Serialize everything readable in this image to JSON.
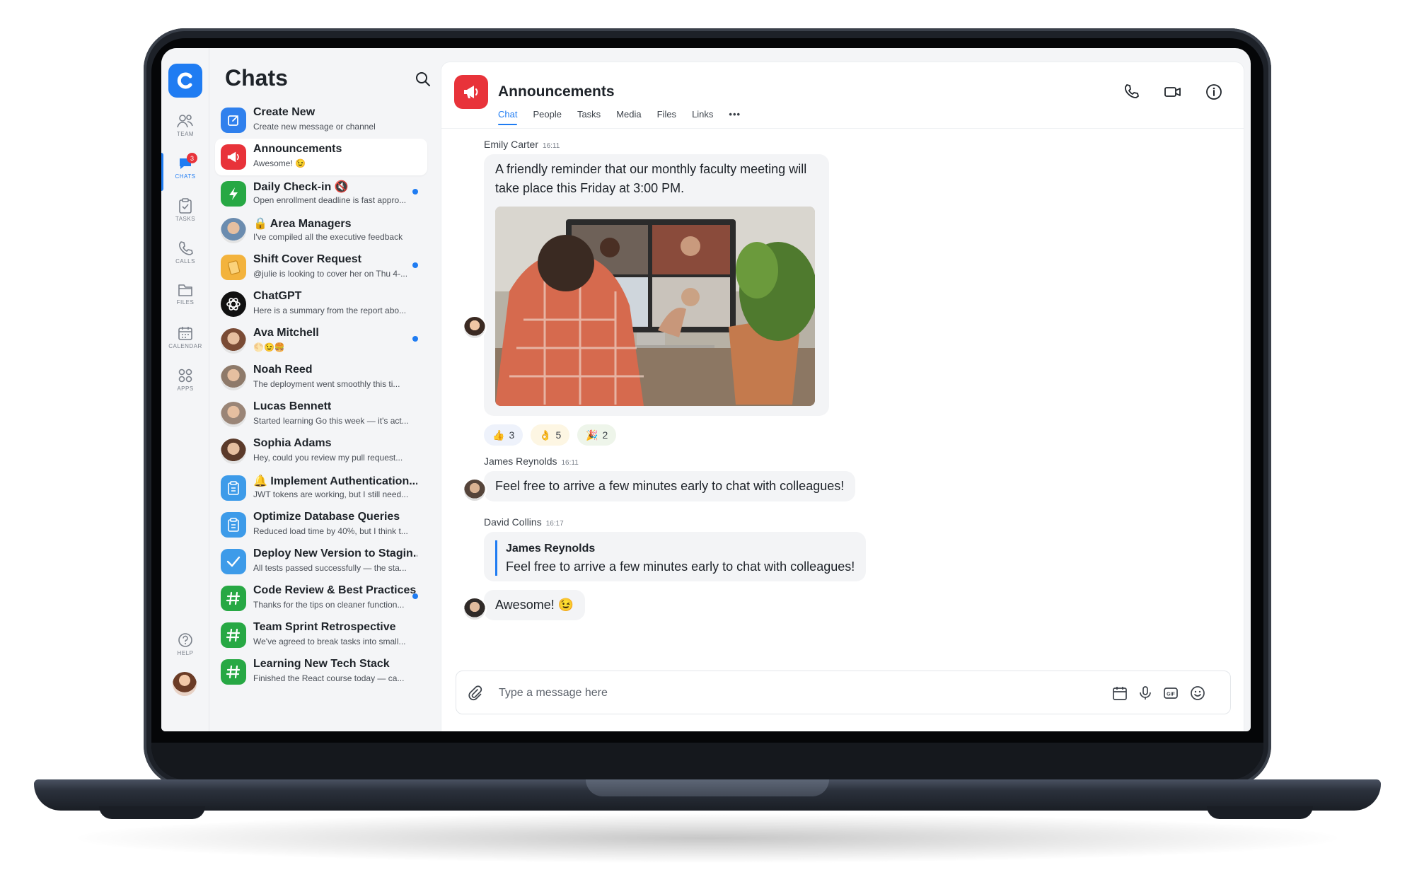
{
  "rail": {
    "items": [
      {
        "label": "TEAM"
      },
      {
        "label": "CHATS",
        "badge": "3"
      },
      {
        "label": "TASKS"
      },
      {
        "label": "CALLS"
      },
      {
        "label": "FILES"
      },
      {
        "label": "CALENDAR"
      },
      {
        "label": "APPS"
      }
    ],
    "help_label": "HELP"
  },
  "chat_list": {
    "title": "Chats",
    "items": [
      {
        "name": "Create New",
        "preview": "Create new message or channel",
        "icon": "compose-icon",
        "color": "#2f80ed"
      },
      {
        "name": "Announcements",
        "preview": "Awesome! 😉",
        "icon": "megaphone-icon",
        "color": "#e8333a"
      },
      {
        "name": "Daily Check-in 🔇",
        "preview": "Open enrollment deadline is fast appro...",
        "icon": "bolt-icon",
        "color": "#27a844",
        "unread": true
      },
      {
        "name": "🔒 Area Managers",
        "preview": "I've compiled all the executive feedback",
        "icon": "group-photo",
        "color": "#6b8caf"
      },
      {
        "name": "Shift Cover Request",
        "preview": "@julie is looking to cover her on Thu 4-...",
        "icon": "notebook-icon",
        "color": "#f3b33d",
        "unread": true
      },
      {
        "name": "ChatGPT",
        "preview": "Here is a summary from the report abo...",
        "icon": "openai-icon",
        "color": "#111111"
      },
      {
        "name": "Ava Mitchell",
        "preview": "🌕😉🍔",
        "icon": "avatar",
        "color": "#7a4b35",
        "unread": true
      },
      {
        "name": "Noah Reed",
        "preview": "The deployment went smoothly this ti...",
        "icon": "avatar",
        "color": "#8e7a6a"
      },
      {
        "name": "Lucas Bennett",
        "preview": "Started learning Go this week — it's act...",
        "icon": "avatar",
        "color": "#9a8577"
      },
      {
        "name": "Sophia Adams",
        "preview": "Hey, could you review my pull request...",
        "icon": "avatar",
        "color": "#5b3a2a"
      },
      {
        "name": "🔔 Implement Authentication...",
        "preview": "JWT tokens are working, but I still need...",
        "icon": "clipboard-icon",
        "color": "#3d9be9"
      },
      {
        "name": "Optimize Database Queries",
        "preview": "Reduced load time by 40%, but I think t...",
        "icon": "clipboard-icon",
        "color": "#3d9be9"
      },
      {
        "name": "Deploy New Version to Stagin...",
        "preview": "All tests passed successfully — the sta...",
        "icon": "check-icon",
        "color": "#3d9be9"
      },
      {
        "name": "Code Review & Best Practices",
        "preview": "Thanks for the tips on cleaner function...",
        "icon": "hash-icon",
        "color": "#27a844",
        "unread": true
      },
      {
        "name": "Team Sprint Retrospective",
        "preview": "We've agreed to break tasks into small...",
        "icon": "hash-icon",
        "color": "#27a844"
      },
      {
        "name": "Learning New Tech Stack",
        "preview": "Finished the React course today — ca...",
        "icon": "hash-icon",
        "color": "#27a844"
      }
    ]
  },
  "channel": {
    "title": "Announcements",
    "tabs": [
      "Chat",
      "People",
      "Tasks",
      "Media",
      "Files",
      "Links",
      "•••"
    ],
    "active_tab": "Chat"
  },
  "messages": [
    {
      "author": "Emily Carter",
      "time": "16:11",
      "text": "A friendly reminder that our monthly faculty meeting will take place this Friday at 3:00 PM.",
      "reactions": [
        {
          "emoji": "👍",
          "count": "3"
        },
        {
          "emoji": "👌",
          "count": "5"
        },
        {
          "emoji": "🎉",
          "count": "2"
        }
      ]
    },
    {
      "author": "James Reynolds",
      "time": "16:11",
      "text": "Feel free to arrive a few minutes early to chat with colleagues!"
    },
    {
      "author": "David Collins",
      "time": "16:17",
      "quote_author": "James Reynolds",
      "quote_text": "Feel free to arrive a few minutes early to chat with colleagues!",
      "text": "Awesome! 😉"
    }
  ],
  "composer": {
    "placeholder": "Type a message here"
  },
  "colors": {
    "accent": "#1f7cf2",
    "danger": "#e8333a",
    "success": "#27a844"
  }
}
